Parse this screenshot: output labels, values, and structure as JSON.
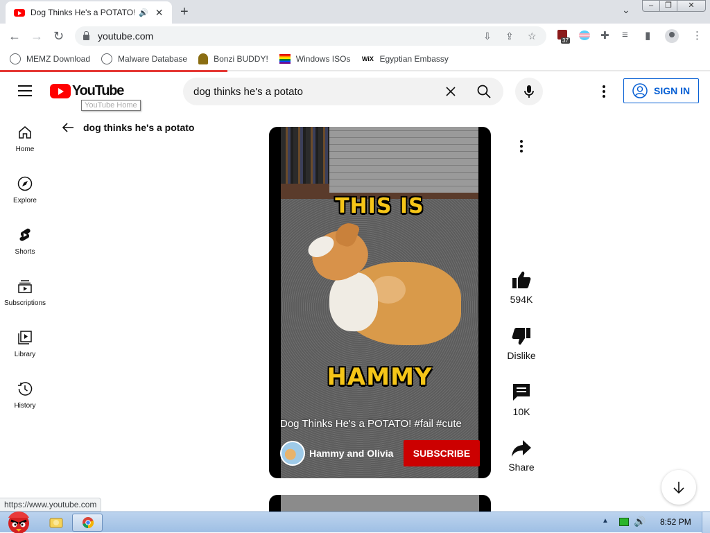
{
  "browser": {
    "tab": {
      "title": "Dog Thinks He's a POTATO! #fail #cute - YouTube"
    },
    "new_tab_label": "+",
    "address": "youtube.com",
    "bookmarks": [
      {
        "label": "MEMZ Download",
        "icon": "globe-icon"
      },
      {
        "label": "Malware Database",
        "icon": "globe-icon"
      },
      {
        "label": "Bonzi BUDDY!",
        "icon": "bonzi-icon"
      },
      {
        "label": "Windows ISOs",
        "icon": "rainbow-flag-icon"
      },
      {
        "label": "Egyptian Embassy",
        "icon": "wix-icon"
      }
    ],
    "extension_badge_count": "37",
    "loading_progress": 0.32,
    "status_url": "https://www.youtube.com"
  },
  "youtube": {
    "logo_text": "YouTube",
    "logo_tooltip": "YouTube Home",
    "search_query": "dog thinks he's a potato",
    "sign_in_label": "SIGN IN",
    "sidebar": [
      {
        "label": "Home",
        "icon": "home-icon"
      },
      {
        "label": "Explore",
        "icon": "compass-icon"
      },
      {
        "label": "Shorts",
        "icon": "shorts-icon"
      },
      {
        "label": "Subscriptions",
        "icon": "subscriptions-icon"
      },
      {
        "label": "Library",
        "icon": "library-icon"
      },
      {
        "label": "History",
        "icon": "history-icon"
      }
    ],
    "results_header": "dog thinks he's a potato",
    "video": {
      "caption_top": "THIS IS",
      "caption_bottom": "HAMMY",
      "title": "Dog Thinks He's a POTATO! #fail #cute",
      "channel": "Hammy and Olivia",
      "subscribe_label": "SUBSCRIBE"
    },
    "actions": {
      "like_count": "594K",
      "dislike_label": "Dislike",
      "comment_count": "10K",
      "share_label": "Share"
    },
    "colors": {
      "brand_red": "#ff0000",
      "subscribe_red": "#cc0000",
      "link_blue": "#065fd4"
    }
  },
  "taskbar": {
    "clock": "8:52 PM"
  }
}
